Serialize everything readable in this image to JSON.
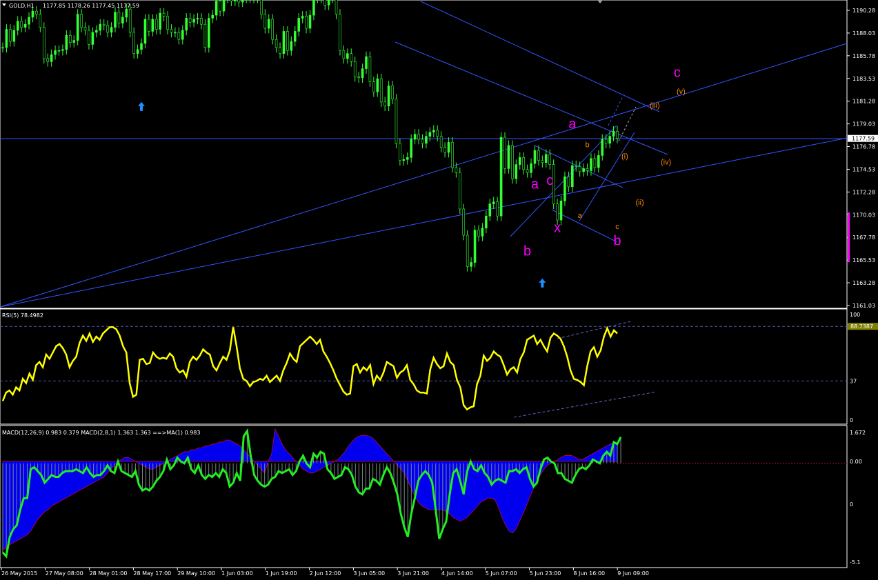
{
  "header": {
    "symbol_label": "GOLD,H1",
    "ohlc": "1177.85 1178.26 1177.45 1177.59",
    "rsi_label": "RSI(5) 78.4982",
    "macd_label": "MACD(12,26,9) 0.983 0.379  MACD(2,8,1) 1.363 1.363  ==>MA(1) 0.983"
  },
  "colors": {
    "bull_candle": "#33ff33",
    "trendline": "#3355ff",
    "wave_major": "#ff00ff",
    "wave_minor": "#ff8800",
    "rsi": "#ffff00",
    "macd_hist": "#0000ee",
    "macd_signal": "#22ee22",
    "arrow": "#1e90ff",
    "current_price_box": "#ffffff",
    "rsi_value_box": "#808000"
  },
  "chart_data": [
    {
      "type": "line",
      "panel": "price",
      "ylim": [
        1161.03,
        1191.5
      ],
      "y_ticks": [
        "1190.28",
        "1188.03",
        "1185.78",
        "1183.53",
        "1181.28",
        "1179.03",
        "1176.78",
        "1174.53",
        "1172.28",
        "1170.03",
        "1167.78",
        "1165.53",
        "1163.28",
        "1161.03"
      ],
      "current_price": "1177.59",
      "x_ticks": [
        "26 May 2015",
        "27 May 08:00",
        "28 May 01:00",
        "28 May 17:00",
        "29 May 10:00",
        "1 Jun 03:00",
        "1 Jun 19:00",
        "2 Jun 12:00",
        "3 Jun 05:00",
        "3 Jun 21:00",
        "4 Jun 14:00",
        "5 Jun 07:00",
        "5 Jun 23:00",
        "8 Jun 16:00",
        "9 Jun 09:00"
      ],
      "series": [
        {
          "values": [
            1186.6,
            1188.4,
            1187.2,
            1188.3,
            1189.2,
            1188.6,
            1188.9,
            1189.6,
            1190.2,
            1189.9,
            1188.6,
            1185.5,
            1185.2,
            1185.9,
            1186.3,
            1186.3,
            1186.4,
            1187.8,
            1187.1,
            1187.3,
            1189.9,
            1188.6,
            1188.3,
            1186.9,
            1188.1,
            1188.3,
            1188.9,
            1188.8,
            1188.1,
            1188.6,
            1190.1,
            1189.0,
            1189.6,
            1190.4,
            1188.1,
            1186.0,
            1186.4,
            1187.0,
            1189.4,
            1188.2,
            1189.4,
            1188.4,
            1190.0,
            1189.7,
            1188.4,
            1188.1,
            1188.1,
            1187.4,
            1188.3,
            1189.5,
            1189.1,
            1189.4,
            1189.5,
            1188.9,
            1186.6,
            1189.5,
            1189.8,
            1191.2,
            1190.2,
            1191.5,
            1191.5,
            1191.2,
            1191.5,
            1191.1,
            1191.5,
            1191.5,
            1191.5,
            1191.5,
            1191.5,
            1189.9,
            1188.5,
            1189.4,
            1187.4,
            1186.6,
            1186.0,
            1188.2,
            1186.3,
            1187.2,
            1188.2,
            1189.5,
            1189.7,
            1188.5,
            1189.8,
            1191.5,
            1191.5,
            1191.5,
            1190.8,
            1191.5,
            1191.5,
            1189.9,
            1186.3,
            1185.5,
            1186.0,
            1185.2,
            1183.7,
            1183.6,
            1184.5,
            1185.7,
            1183.2,
            1182.2,
            1183.5,
            1181.2,
            1180.8,
            1182.8,
            1181.5,
            1177.1,
            1175.4,
            1175.5,
            1175.7,
            1177.5,
            1178.0,
            1177.5,
            1177.1,
            1177.8,
            1178.2,
            1178.4,
            1177.8,
            1176.7,
            1176.2,
            1177.2,
            1174.7,
            1174.2,
            1170.6,
            1168.0,
            1164.9,
            1165.3,
            1168.5,
            1167.9,
            1168.7,
            1169.9,
            1171.1,
            1171.3,
            1169.9,
            1177.7,
            1174.6,
            1176.9,
            1173.6,
            1175.0,
            1175.7,
            1174.5,
            1174.2,
            1175.1,
            1176.4,
            1175.4,
            1175.2,
            1176.0,
            1175.0,
            1171.1,
            1169.5,
            1171.4,
            1173.8,
            1172.8,
            1174.9,
            1174.8,
            1174.3,
            1174.6,
            1174.4,
            1175.6,
            1174.7,
            1175.9,
            1177.5,
            1177.1,
            1177.8,
            1178.3,
            1177.6
          ]
        }
      ]
    },
    {
      "type": "line",
      "panel": "rsi",
      "ylim": [
        0,
        100
      ],
      "y_ticks": [
        "100",
        "37",
        "0"
      ],
      "levels": [
        88.7387,
        37
      ],
      "current_value": "88.7387",
      "series": [
        {
          "values": [
            18,
            26,
            28,
            24,
            31,
            28,
            39,
            35,
            44,
            38,
            52,
            55,
            50,
            62,
            58,
            64,
            70,
            72,
            68,
            62,
            50,
            56,
            60,
            73,
            80,
            75,
            82,
            74,
            79,
            76,
            82,
            85,
            88,
            88,
            86,
            80,
            70,
            64,
            35,
            22,
            24,
            57,
            58,
            53,
            54,
            64,
            60,
            58,
            59,
            58,
            63,
            60,
            49,
            45,
            47,
            41,
            55,
            60,
            57,
            61,
            67,
            64,
            62,
            51,
            47,
            54,
            60,
            57,
            66,
            88,
            70,
            49,
            39,
            37,
            32,
            36,
            37,
            39,
            38,
            42,
            36,
            39,
            42,
            37,
            47,
            54,
            63,
            58,
            55,
            70,
            73,
            76,
            79,
            76,
            72,
            76,
            65,
            60,
            54,
            47,
            39,
            33,
            27,
            24,
            25,
            51,
            53,
            45,
            50,
            47,
            52,
            34,
            42,
            38,
            45,
            55,
            53,
            51,
            40,
            45,
            47,
            52,
            38,
            34,
            28,
            26,
            26,
            25,
            48,
            59,
            53,
            49,
            51,
            63,
            55,
            52,
            38,
            31,
            14,
            10,
            12,
            13,
            34,
            42,
            61,
            56,
            59,
            65,
            62,
            60,
            52,
            43,
            48,
            50,
            45,
            58,
            64,
            76,
            78,
            80,
            72,
            76,
            70,
            65,
            78,
            82,
            80,
            77,
            70,
            60,
            47,
            39,
            38,
            36,
            33,
            51,
            65,
            69,
            60,
            66,
            79,
            87,
            79,
            85,
            82
          ]
        }
      ]
    },
    {
      "type": "bar",
      "panel": "macd",
      "ylim": [
        -5.1,
        1.672
      ],
      "y_ticks": [
        "1.672",
        "0.00",
        "0",
        "-5.1"
      ],
      "series": [
        {
          "name": "MACD(12,26,9)",
          "values": [
            -4.6,
            -4.4,
            -4.3,
            -4.2,
            -4.1,
            -4.0,
            -3.9,
            -3.8,
            -3.6,
            -3.3,
            -3.0,
            -2.8,
            -2.6,
            -2.5,
            -2.3,
            -2.2,
            -2.1,
            -2.0,
            -1.9,
            -1.8,
            -1.7,
            -1.6,
            -1.5,
            -1.4,
            -1.3,
            -1.2,
            -1.1,
            -1.0,
            -0.9,
            -0.8,
            -0.6,
            -0.4,
            -0.2,
            0.0,
            0.1,
            0.2,
            0.2,
            0.1,
            0.0,
            -0.1,
            -0.2,
            -0.3,
            -0.4,
            -0.4,
            -0.3,
            -0.2,
            -0.1,
            0.0,
            0.1,
            0.2,
            0.3,
            0.4,
            0.5,
            0.5,
            0.6,
            0.6,
            0.7,
            0.7,
            0.8,
            0.8,
            0.9,
            0.9,
            1.0,
            1.0,
            1.1,
            1.1,
            1.0,
            0.9,
            0.8,
            0.6,
            0.4,
            0.2,
            0.0,
            -0.2,
            -0.4,
            -0.6,
            0.0,
            0.4,
            1.672,
            1.3,
            0.9,
            0.6,
            0.4,
            0.2,
            0.0,
            -0.2,
            -0.4,
            -0.5,
            -0.6,
            -0.6,
            -0.5,
            -0.4,
            -0.3,
            -0.2,
            -0.1,
            0.0,
            0.1,
            0.3,
            0.5,
            0.8,
            1.0,
            1.2,
            1.3,
            1.35,
            1.35,
            1.3,
            1.2,
            1.0,
            0.8,
            0.6,
            0.4,
            0.2,
            0.0,
            -0.2,
            -0.4,
            -0.6,
            -1.0,
            -1.4,
            -1.8,
            -2.1,
            -2.3,
            -2.4,
            -2.5,
            -2.5,
            -2.5,
            -2.5,
            -2.5,
            -2.6,
            -2.7,
            -2.9,
            -3.0,
            -3.1,
            -3.0,
            -2.9,
            -2.7,
            -2.5,
            -2.3,
            -2.1,
            -2.0,
            -1.9,
            -1.9,
            -2.0,
            -2.4,
            -2.9,
            -3.3,
            -3.6,
            -3.7,
            -3.5,
            -3.1,
            -2.7,
            -2.3,
            -1.8,
            -1.4,
            -1.0,
            -0.7,
            -0.4,
            -0.2,
            -0.1,
            0.0,
            0.1,
            0.2,
            0.3,
            0.3,
            0.3,
            0.2,
            0.1,
            0.1,
            0.2,
            0.3,
            0.4,
            0.5,
            0.6,
            0.7,
            0.8,
            0.9,
            0.95,
            0.983
          ]
        },
        {
          "name": "MACD(2,8,1)",
          "values": [
            -4.6,
            -4.8,
            -3.8,
            -3.4,
            -3.2,
            -2.4,
            -1.8,
            -1.8,
            -0.3,
            -0.2,
            -0.4,
            -0.6,
            -1.0,
            -0.8,
            -0.6,
            -0.7,
            -0.7,
            -0.5,
            -0.4,
            -0.4,
            -0.4,
            -0.3,
            -0.4,
            -0.5,
            -0.2,
            -0.5,
            -0.7,
            -0.6,
            -0.6,
            -0.4,
            -0.1,
            -0.4,
            -0.5,
            0.1,
            -0.4,
            -0.5,
            -0.6,
            -0.7,
            -0.4,
            -1.1,
            -1.4,
            -1.3,
            -1.4,
            -1.2,
            -0.9,
            -0.7,
            -0.4,
            0.2,
            -0.3,
            -0.1,
            0.3,
            0.1,
            0.0,
            0.3,
            -0.3,
            -0.5,
            -0.1,
            -0.6,
            -0.8,
            -0.6,
            -0.7,
            -0.5,
            -0.7,
            -0.3,
            -0.5,
            -1.2,
            -1.0,
            -0.5,
            -0.9,
            1.4,
            1.672,
            0.4,
            -0.6,
            -0.9,
            -1.1,
            -1.2,
            -1.1,
            -0.8,
            -0.7,
            -0.4,
            -0.5,
            -0.4,
            -0.3,
            -0.6,
            -0.4,
            0.1,
            0.4,
            0.0,
            -0.2,
            0.5,
            0.3,
            0.6,
            0.5,
            -0.3,
            -0.5,
            -0.8,
            -0.7,
            -0.6,
            -0.2,
            -0.3,
            -0.6,
            -1.2,
            -1.5,
            -1.6,
            -1.3,
            -1.3,
            -0.8,
            -0.9,
            -1.1,
            -0.6,
            -0.2,
            -0.5,
            -1.0,
            -1.6,
            -2.6,
            -3.3,
            -3.8,
            -2.6,
            -1.8,
            -0.9,
            -0.6,
            -0.4,
            -0.6,
            -1.0,
            -2.4,
            -3.9,
            -3.4,
            -3.0,
            -1.6,
            -0.5,
            -0.3,
            -0.9,
            -1.6,
            -0.4,
            0.1,
            -0.3,
            -0.4,
            -0.1,
            -0.5,
            -0.7,
            -1.1,
            -0.9,
            -0.8,
            -0.9,
            -1.0,
            -0.4,
            -0.4,
            -0.3,
            -0.5,
            -0.3,
            -0.2,
            -0.8,
            -1.2,
            -1.0,
            -0.3,
            0.2,
            0.3,
            0.1,
            0.0,
            -0.5,
            -0.5,
            -0.8,
            -0.9,
            -1.0,
            -0.6,
            -0.3,
            -0.2,
            -0.3,
            -0.1,
            0.2,
            0.1,
            0.0,
            0.4,
            0.6,
            0.4,
            1.1,
            1.0,
            1.363
          ]
        }
      ]
    }
  ],
  "wave_labels": {
    "major": [
      {
        "text": "a",
        "time": 142,
        "price": 1172.6
      },
      {
        "text": "c",
        "time": 146,
        "price": 1173.0
      },
      {
        "text": "x",
        "time": 148,
        "price": 1168.3
      },
      {
        "text": "b",
        "time": 140,
        "price": 1166.0
      },
      {
        "text": "a",
        "time": 152,
        "price": 1178.6
      },
      {
        "text": "b",
        "time": 164,
        "price": 1167.0
      },
      {
        "text": "c",
        "time": 180,
        "price": 1183.7
      }
    ],
    "minor": [
      {
        "text": "b",
        "time": 156,
        "price": 1176.7
      },
      {
        "text": "a",
        "time": 154,
        "price": 1169.7
      },
      {
        "text": "c",
        "time": 164,
        "price": 1168.6
      },
      {
        "text": "(i)",
        "time": 166,
        "price": 1175.6
      },
      {
        "text": "(ii)",
        "time": 170,
        "price": 1171.0
      },
      {
        "text": "(iii)",
        "time": 174,
        "price": 1180.6
      },
      {
        "text": "(iv)",
        "time": 177,
        "price": 1175.0
      },
      {
        "text": "(v)",
        "time": 181,
        "price": 1182.0
      }
    ]
  },
  "signal_arrows": [
    {
      "time": 37,
      "price": 1181.2
    },
    {
      "time": 144,
      "price": 1163.7
    }
  ]
}
